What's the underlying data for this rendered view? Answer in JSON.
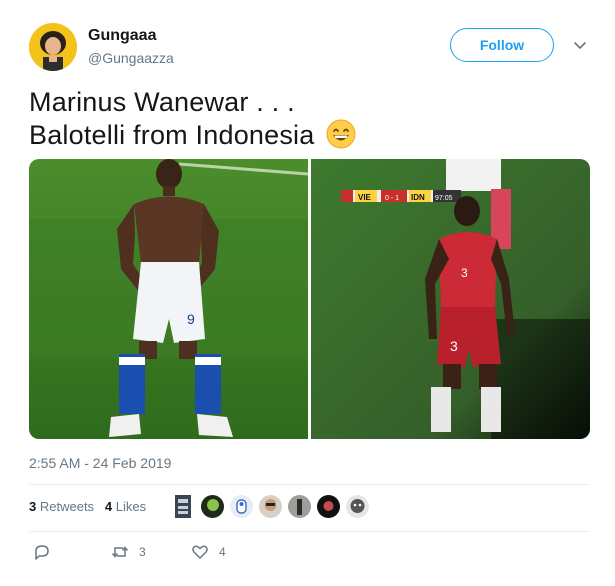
{
  "author": {
    "name": "Gungaaa",
    "handle": "@Gungaazza",
    "avatar_icon": "avatar-icon"
  },
  "follow_button": {
    "label": "Follow"
  },
  "tweet": {
    "line1": "Marinus Wanewar . . .",
    "line2": "Balotelli from Indonesia",
    "emoji": "grinning-face-emoji"
  },
  "media": {
    "left_number": "9",
    "right_number": "3",
    "score_team1": "VIE",
    "score_value": "0 - 1",
    "score_team2": "IDN",
    "score_time": "97:05"
  },
  "timestamp": "2:55 AM - 24 Feb 2019",
  "stats": {
    "retweets_count": "3",
    "retweets_label": "Retweets",
    "likes_count": "4",
    "likes_label": "Likes"
  },
  "actions": {
    "reply_count": "",
    "retweet_count": "3",
    "like_count": "4"
  },
  "colors": {
    "accent": "#1da1f2",
    "secondary_text": "#657786",
    "divider": "#e6ecf0"
  }
}
